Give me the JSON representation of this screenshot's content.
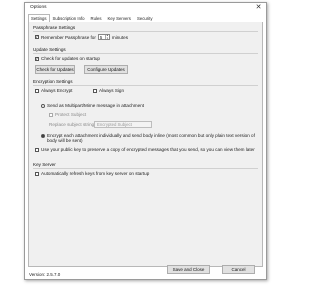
{
  "window": {
    "title": "Options",
    "close_glyph": "✕"
  },
  "tabs": [
    {
      "label": "Settings",
      "active": true
    },
    {
      "label": "Subscription Info"
    },
    {
      "label": "Rules"
    },
    {
      "label": "Key Servers"
    },
    {
      "label": "Security"
    }
  ],
  "passphrase": {
    "group": "Passphrase Settings",
    "remember_label": "Remember Passphrase for",
    "minutes_value": "5",
    "minutes_suffix": "minutes"
  },
  "update": {
    "group": "Update Settings",
    "check_startup_label": "Check for updates on startup",
    "check_button": "Check for Updates",
    "configure_button": "Configure Updates"
  },
  "encryption": {
    "group": "Encryption Settings",
    "always_encrypt": "Always Encrypt",
    "always_sign": "Always Sign",
    "send_multipart": "Send as Multipart/Mime message in attachment",
    "protect_subject": "Protect Subject",
    "replace_subject_label": "Replace subject string",
    "replace_subject_value": "Encrypted Subject",
    "encrypt_each": "Encrypt each attachment individually and send body inline (most common but only plain text version of body will be sent)",
    "use_public_key": "Use your public key to preserve a copy of encrypted messages that you send, so you can view them later"
  },
  "keyserver": {
    "group": "Key Server",
    "auto_refresh": "Automatically refresh keys from key server on startup"
  },
  "footer": {
    "save_close": "Save and Close",
    "cancel": "Cancel",
    "version": "Version: 2.5.7.0"
  },
  "icons": {
    "checkmark": "check-icon",
    "close": "close-icon",
    "spinner": "spinner-arrows-icon"
  }
}
